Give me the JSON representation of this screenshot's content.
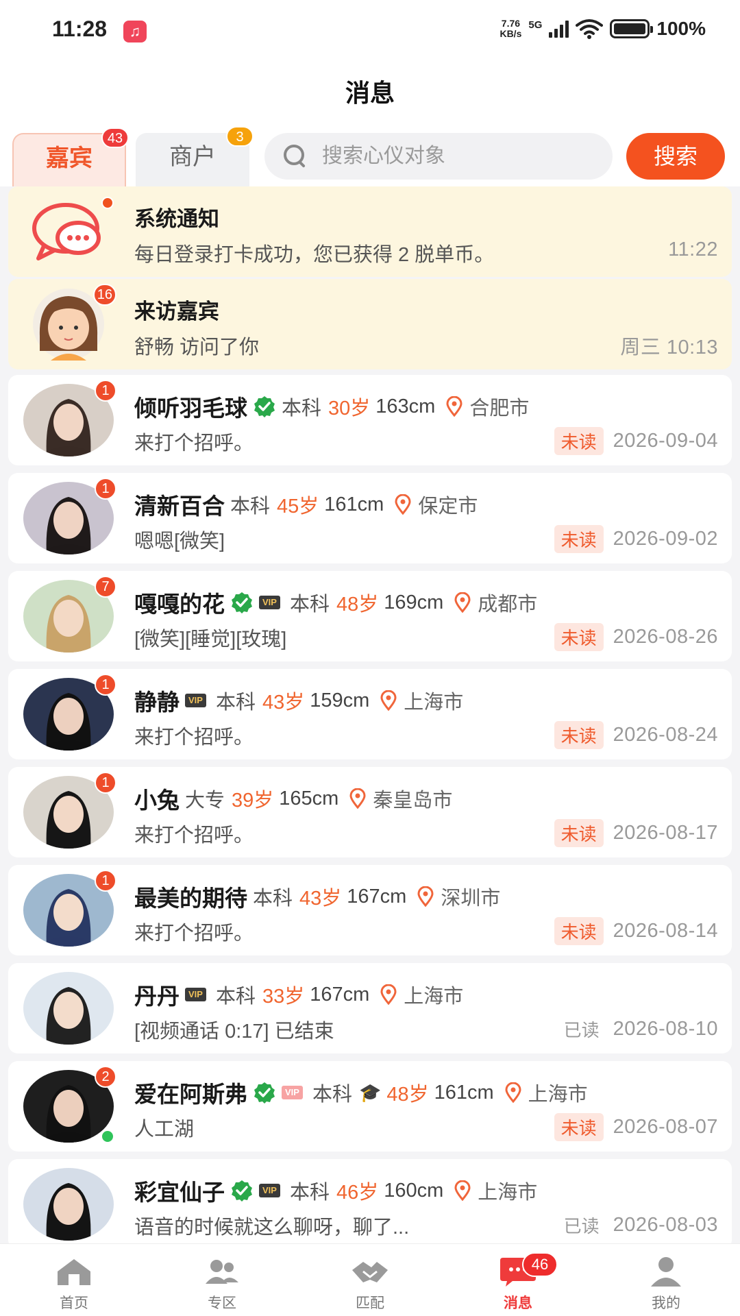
{
  "status_bar": {
    "time": "11:28",
    "net_speed_value": "7.76",
    "net_speed_unit": "KB/s",
    "network": "5G",
    "battery": "100%"
  },
  "header": {
    "title": "消息"
  },
  "tabs": [
    {
      "label": "嘉宾",
      "badge": "43",
      "active": true
    },
    {
      "label": "商户",
      "badge": "3",
      "active": false
    }
  ],
  "search": {
    "placeholder": "搜索心仪对象",
    "value": "",
    "button_label": "搜索"
  },
  "pinned": [
    {
      "title": "系统通知",
      "message": "每日登录打卡成功，您已获得 2 脱单币。",
      "time": "11:22",
      "icon": "chat-bubble-icon"
    },
    {
      "title": "来访嘉宾",
      "message": "舒畅 访问了你",
      "time": "周三 10:13",
      "badge": "16"
    }
  ],
  "conversations": [
    {
      "name": "倾听羽毛球",
      "verified": true,
      "vip": false,
      "education": "本科",
      "age": "30岁",
      "height": "163cm",
      "city": "合肥市",
      "message": "来打个招呼。",
      "status": "未读",
      "date": "2026-09-04",
      "badge": "1"
    },
    {
      "name": "清新百合",
      "verified": false,
      "vip": false,
      "education": "本科",
      "age": "45岁",
      "height": "161cm",
      "city": "保定市",
      "message": "嗯嗯[微笑]",
      "status": "未读",
      "date": "2026-09-02",
      "badge": "1"
    },
    {
      "name": "嘎嘎的花",
      "verified": true,
      "vip": true,
      "education": "本科",
      "age": "48岁",
      "height": "169cm",
      "city": "成都市",
      "message": "[微笑][睡觉][玫瑰]",
      "status": "未读",
      "date": "2026-08-26",
      "badge": "7"
    },
    {
      "name": "静静",
      "verified": false,
      "vip": true,
      "education": "本科",
      "age": "43岁",
      "height": "159cm",
      "city": "上海市",
      "message": "来打个招呼。",
      "status": "未读",
      "date": "2026-08-24",
      "badge": "1"
    },
    {
      "name": "小兔",
      "verified": false,
      "vip": false,
      "education": "大专",
      "age": "39岁",
      "height": "165cm",
      "city": "秦皇岛市",
      "message": "来打个招呼。",
      "status": "未读",
      "date": "2026-08-17",
      "badge": "1"
    },
    {
      "name": "最美的期待",
      "verified": false,
      "vip": false,
      "education": "本科",
      "age": "43岁",
      "height": "167cm",
      "city": "深圳市",
      "message": "来打个招呼。",
      "status": "未读",
      "date": "2026-08-14",
      "badge": "1"
    },
    {
      "name": "丹丹",
      "verified": false,
      "vip": true,
      "education": "本科",
      "age": "33岁",
      "height": "167cm",
      "city": "上海市",
      "message": "[视频通话 0:17] 已结束",
      "status": "已读",
      "date": "2026-08-10",
      "badge": ""
    },
    {
      "name": "爱在阿斯弗",
      "verified": true,
      "vip": true,
      "vip_light": true,
      "grad": true,
      "education": "本科",
      "age": "48岁",
      "height": "161cm",
      "city": "上海市",
      "message": "人工湖",
      "status": "未读",
      "date": "2026-08-07",
      "badge": "2",
      "online": true
    },
    {
      "name": "彩宜仙子",
      "verified": true,
      "vip": true,
      "education": "本科",
      "age": "46岁",
      "height": "160cm",
      "city": "上海市",
      "message": "语音的时候就这么聊呀，聊了...",
      "status": "已读",
      "date": "2026-08-03",
      "badge": ""
    }
  ],
  "vip_label": "VIP",
  "bottom_nav": [
    {
      "label": "首页",
      "icon": "home-icon"
    },
    {
      "label": "专区",
      "icon": "users-icon"
    },
    {
      "label": "匹配",
      "icon": "handshake-icon"
    },
    {
      "label": "消息",
      "icon": "message-icon",
      "badge": "46",
      "active": true
    },
    {
      "label": "我的",
      "icon": "profile-icon"
    }
  ],
  "colors": {
    "accent": "#f4521f",
    "unread_tag_bg": "#fde6df",
    "pinned_bg": "#fdf6df",
    "age": "#f0652f",
    "verified": "#2aa84a"
  }
}
